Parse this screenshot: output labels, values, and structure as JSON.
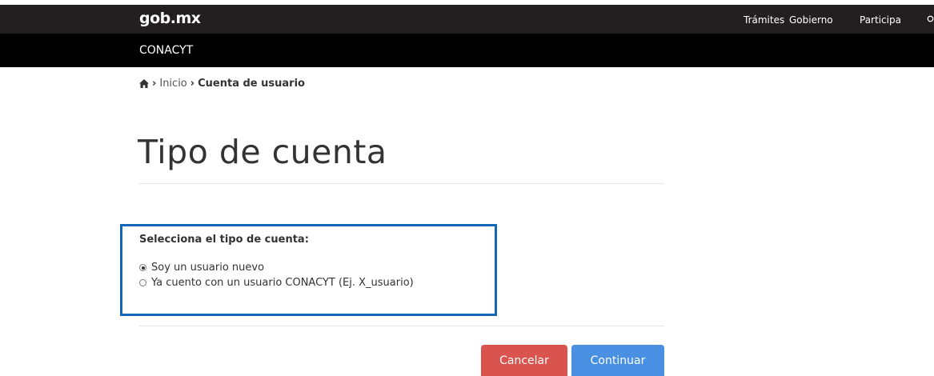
{
  "header": {
    "logo": "gob.mx",
    "nav": [
      "Trámites",
      "Gobierno",
      "Participa"
    ],
    "search_icon": "search-icon"
  },
  "subheader": {
    "name": "CONACYT"
  },
  "breadcrumb": {
    "home_icon": "home-icon",
    "items": [
      "Inicio",
      "Cuenta de usuario"
    ]
  },
  "page": {
    "title": "Tipo de cuenta"
  },
  "form": {
    "label": "Selecciona el tipo de cuenta:",
    "options": [
      {
        "label": "Soy un usuario nuevo",
        "selected": true
      },
      {
        "label": "Ya cuento con un usuario CONACYT (Ej. X_usuario)",
        "selected": false
      }
    ]
  },
  "actions": {
    "cancel_label": "Cancelar",
    "continue_label": "Continuar"
  },
  "colors": {
    "header_bg": "#231f20",
    "subheader_bg": "#000000",
    "highlight_border": "#1467b8",
    "cancel_bg": "#d9534f",
    "continue_bg": "#4a90e2"
  }
}
